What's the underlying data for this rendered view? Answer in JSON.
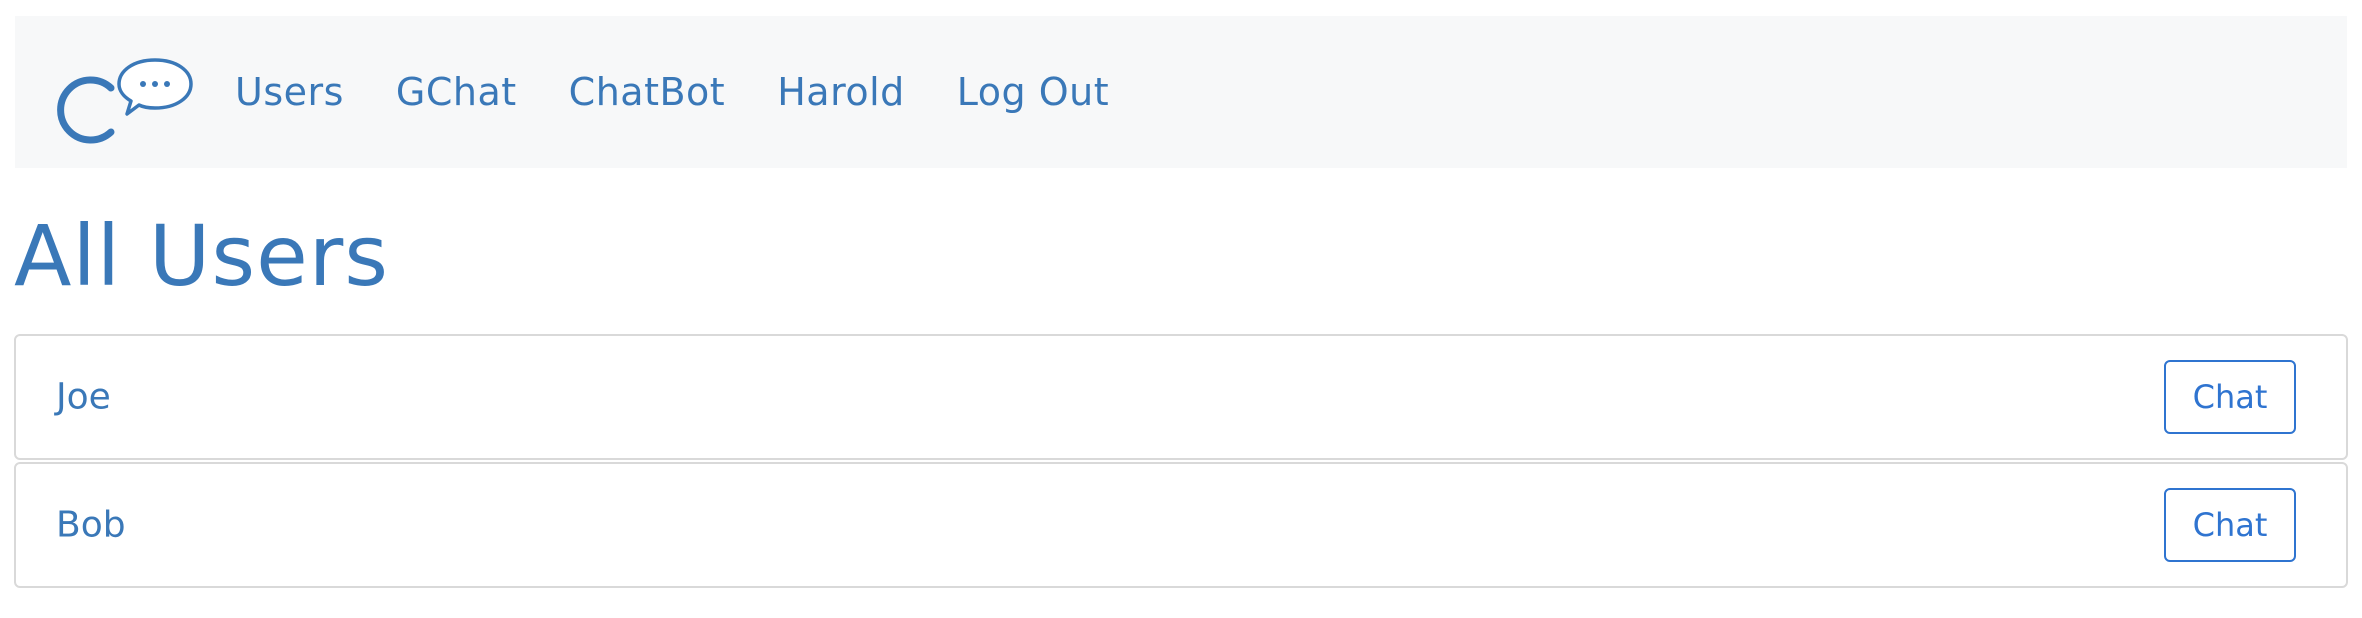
{
  "colors": {
    "primary_text": "#3a78b8",
    "navbar_bg": "#f7f8f9",
    "button_border": "#2f74d0",
    "row_border": "#d9d9d9"
  },
  "navbar": {
    "logo_icon": "chat-logo-icon",
    "links": [
      {
        "label": "Users"
      },
      {
        "label": "GChat"
      },
      {
        "label": "ChatBot"
      },
      {
        "label": "Harold"
      },
      {
        "label": "Log Out"
      }
    ]
  },
  "main": {
    "title": "All Users",
    "users": [
      {
        "name": "Joe",
        "button_label": "Chat"
      },
      {
        "name": "Bob",
        "button_label": "Chat"
      }
    ]
  }
}
